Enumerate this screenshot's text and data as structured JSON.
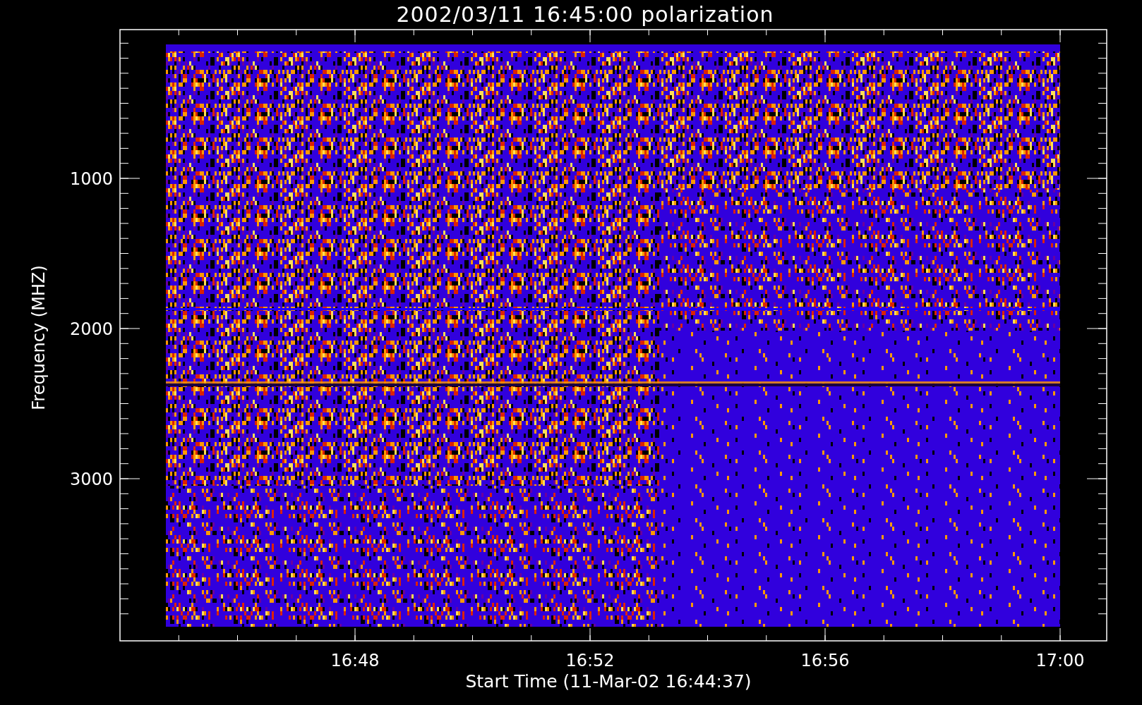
{
  "title": "2002/03/11 16:45:00 polarization",
  "x_axis": {
    "label": "Start Time (11-Mar-02 16:44:37)",
    "ticks": [
      "16:48",
      "16:52",
      "16:56",
      "17:00"
    ]
  },
  "y_axis": {
    "label": "Frequency (MHZ)",
    "ticks": [
      "1000",
      "2000",
      "3000"
    ]
  }
}
